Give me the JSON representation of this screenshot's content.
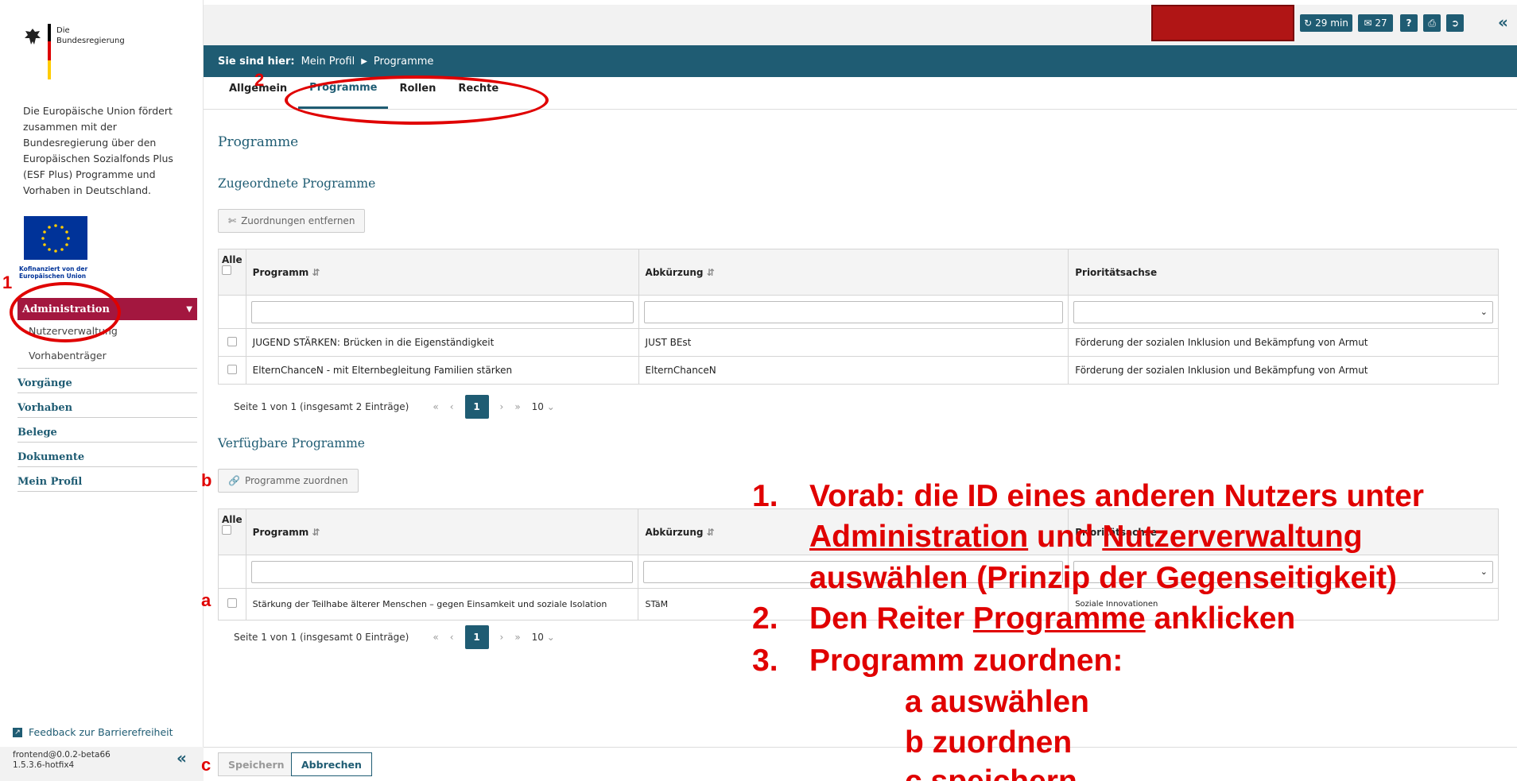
{
  "sidebar": {
    "gov_logo_line1": "Die",
    "gov_logo_line2": "Bundesregierung",
    "intro_text": "Die Europäische Union fördert zusammen mit der Bundesregierung über den Europäischen Sozialfonds Plus (ESF Plus) Programme und Vorhaben in Deutschland.",
    "eu_caption_line1": "Kofinanziert von der",
    "eu_caption_line2": "Europäischen Union",
    "menu_admin": "Administration",
    "menu_admin_sub1": "Nutzerverwaltung",
    "menu_admin_sub2": "Vorhabenträger",
    "menu_vorgaenge": "Vorgänge",
    "menu_vorhaben": "Vorhaben",
    "menu_belege": "Belege",
    "menu_dokumente": "Dokumente",
    "menu_profil": "Mein Profil",
    "feedback": "Feedback zur Barrierefreiheit",
    "version_line1": "frontend@0.0.2-beta66",
    "version_line2": "1.5.3.6-hotfix4"
  },
  "topbar": {
    "session": "29 min",
    "messages": "27"
  },
  "breadcrumb": {
    "prefix": "Sie sind hier:",
    "item1": "Mein Profil",
    "item2": "Programme"
  },
  "tabs": [
    "Allgemein",
    "Programme",
    "Rollen",
    "Rechte"
  ],
  "page": {
    "title": "Programme",
    "assigned_heading": "Zugeordnete Programme",
    "remove_button": "Zuordnungen entfernen",
    "available_heading": "Verfügbare Programme",
    "assign_button": "Programme zuordnen",
    "col_all": "Alle",
    "col_programm": "Programm",
    "col_abk": "Abkürzung",
    "col_achse": "Prioritätsachse",
    "assigned_rows": [
      {
        "programm": "JUGEND STÄRKEN: Brücken in die Eigenständigkeit",
        "abk": "JUST BEst",
        "achse": "Förderung der sozialen Inklusion und Bekämpfung von Armut"
      },
      {
        "programm": "ElternChanceN - mit Elternbegleitung Familien stärken",
        "abk": "ElternChanceN",
        "achse": "Förderung der sozialen Inklusion und Bekämpfung von Armut"
      }
    ],
    "available_rows": [
      {
        "programm": "Stärkung der Teilhabe älterer Menschen – gegen Einsamkeit und soziale Isolation",
        "abk": "STäM",
        "achse": "Soziale Innovationen"
      }
    ],
    "pager1_text": "Seite 1 von 1 (insgesamt 2 Einträge)",
    "pager2_text": "Seite 1 von 1 (insgesamt 0 Einträge)",
    "page_number": "1",
    "page_size": "10",
    "save_button": "Speichern",
    "cancel_button": "Abbrechen"
  },
  "annotations": {
    "n1": "1",
    "n2": "2",
    "a": "a",
    "b": "b",
    "c": "c",
    "step1_num": "1.",
    "step1_l1": "Vorab: die ID eines anderen Nutzers unter",
    "step1_l2_u1": "Administration",
    "step1_l2_mid": " und ",
    "step1_l2_u2": "Nutzerverwaltung",
    "step1_l3": "auswählen (Prinzip der Gegenseitigkeit)",
    "step2_num": "2.",
    "step2_pre": "Den Reiter ",
    "step2_u": "Programme",
    "step2_post": " anklicken",
    "step3_num": "3.",
    "step3": "Programm zuordnen:",
    "sub_a": "a auswählen",
    "sub_b": "b zuordnen",
    "sub_c": "c speichern"
  },
  "colors": {
    "primary": "#1f5c73",
    "admin_menu": "#a3173f",
    "annotation": "#e00000",
    "redacted": "#b01515"
  }
}
